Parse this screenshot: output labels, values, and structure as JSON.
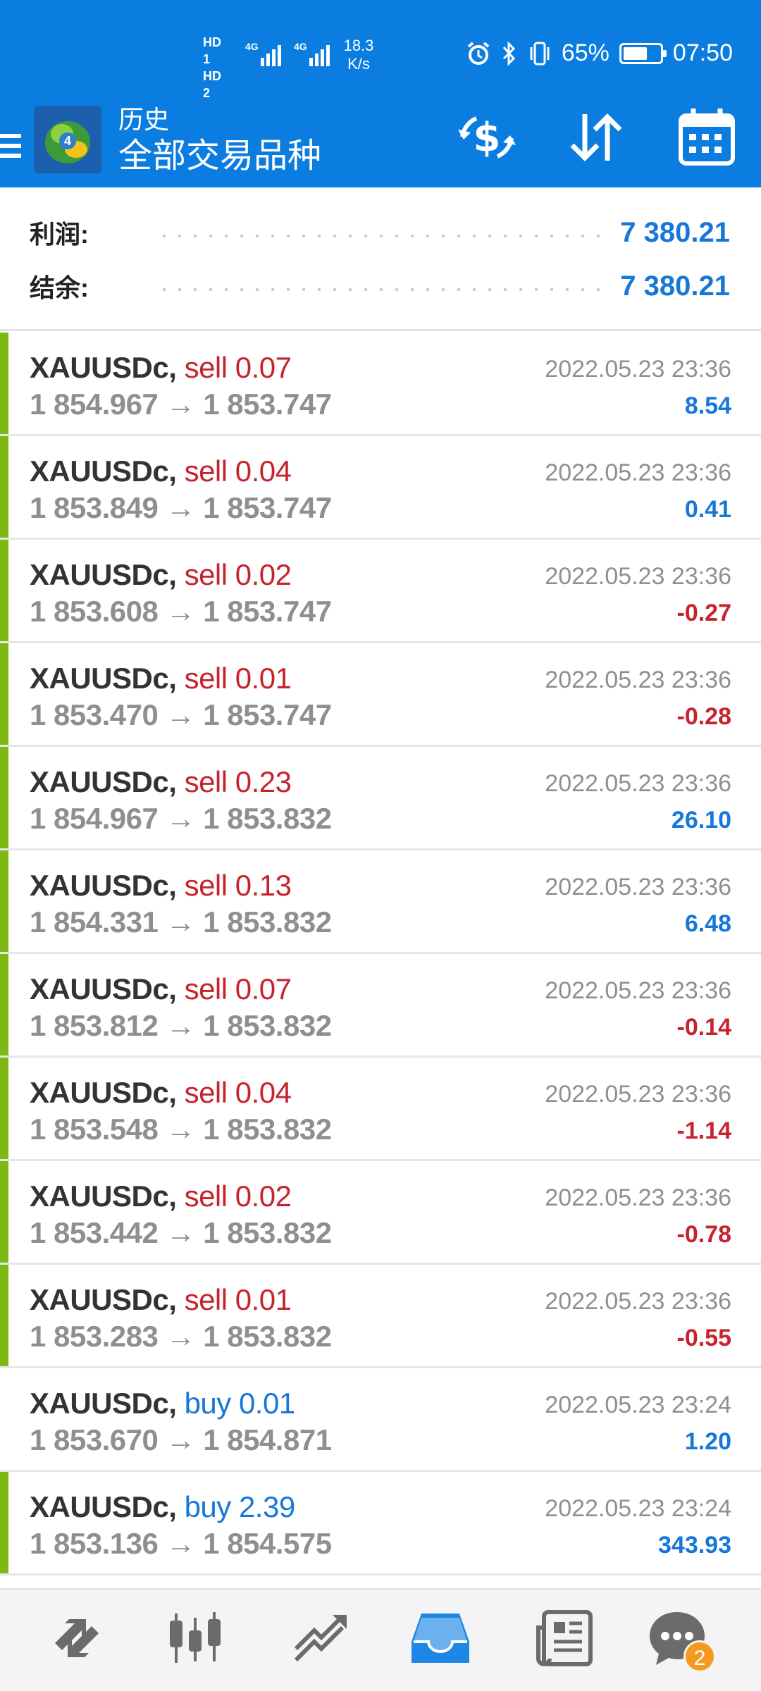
{
  "status_bar": {
    "sim1": "HD 1",
    "sim2": "HD 2",
    "network1": "4G",
    "network2": "4G",
    "speed_value": "18.3",
    "speed_unit": "K/s",
    "battery": "65%",
    "battery_level": 0.65,
    "time": "07:50"
  },
  "header": {
    "subtitle": "历史",
    "title": "全部交易品种"
  },
  "summary": {
    "profit_label": "利润:",
    "profit_value": "7 380.21",
    "balance_label": "结余:",
    "balance_value": "7 380.21"
  },
  "deals": [
    {
      "symbol": "XAUUSDc,",
      "side": "sell",
      "volume": "0.07",
      "open": "1 854.967",
      "close": "1 853.747",
      "time": "2022.05.23 23:36",
      "profit": "8.54",
      "profit_sign": "pos",
      "marked": true
    },
    {
      "symbol": "XAUUSDc,",
      "side": "sell",
      "volume": "0.04",
      "open": "1 853.849",
      "close": "1 853.747",
      "time": "2022.05.23 23:36",
      "profit": "0.41",
      "profit_sign": "pos",
      "marked": true
    },
    {
      "symbol": "XAUUSDc,",
      "side": "sell",
      "volume": "0.02",
      "open": "1 853.608",
      "close": "1 853.747",
      "time": "2022.05.23 23:36",
      "profit": "-0.27",
      "profit_sign": "neg",
      "marked": true
    },
    {
      "symbol": "XAUUSDc,",
      "side": "sell",
      "volume": "0.01",
      "open": "1 853.470",
      "close": "1 853.747",
      "time": "2022.05.23 23:36",
      "profit": "-0.28",
      "profit_sign": "neg",
      "marked": true
    },
    {
      "symbol": "XAUUSDc,",
      "side": "sell",
      "volume": "0.23",
      "open": "1 854.967",
      "close": "1 853.832",
      "time": "2022.05.23 23:36",
      "profit": "26.10",
      "profit_sign": "pos",
      "marked": true
    },
    {
      "symbol": "XAUUSDc,",
      "side": "sell",
      "volume": "0.13",
      "open": "1 854.331",
      "close": "1 853.832",
      "time": "2022.05.23 23:36",
      "profit": "6.48",
      "profit_sign": "pos",
      "marked": true
    },
    {
      "symbol": "XAUUSDc,",
      "side": "sell",
      "volume": "0.07",
      "open": "1 853.812",
      "close": "1 853.832",
      "time": "2022.05.23 23:36",
      "profit": "-0.14",
      "profit_sign": "neg",
      "marked": true
    },
    {
      "symbol": "XAUUSDc,",
      "side": "sell",
      "volume": "0.04",
      "open": "1 853.548",
      "close": "1 853.832",
      "time": "2022.05.23 23:36",
      "profit": "-1.14",
      "profit_sign": "neg",
      "marked": true
    },
    {
      "symbol": "XAUUSDc,",
      "side": "sell",
      "volume": "0.02",
      "open": "1 853.442",
      "close": "1 853.832",
      "time": "2022.05.23 23:36",
      "profit": "-0.78",
      "profit_sign": "neg",
      "marked": true
    },
    {
      "symbol": "XAUUSDc,",
      "side": "sell",
      "volume": "0.01",
      "open": "1 853.283",
      "close": "1 853.832",
      "time": "2022.05.23 23:36",
      "profit": "-0.55",
      "profit_sign": "neg",
      "marked": true
    },
    {
      "symbol": "XAUUSDc,",
      "side": "buy",
      "volume": "0.01",
      "open": "1 853.670",
      "close": "1 854.871",
      "time": "2022.05.23 23:24",
      "profit": "1.20",
      "profit_sign": "pos",
      "marked": false
    },
    {
      "symbol": "XAUUSDc,",
      "side": "buy",
      "volume": "2.39",
      "open": "1 853.136",
      "close": "1 854.575",
      "time": "2022.05.23 23:24",
      "profit": "343.93",
      "profit_sign": "pos",
      "marked": true
    }
  ],
  "arrow_glyph": "→",
  "bottom_nav": {
    "items": [
      "quotes-icon",
      "chart-icon",
      "trade-icon",
      "history-icon",
      "news-icon",
      "chat-icon"
    ],
    "active": "history-icon",
    "chat_badge": "2"
  },
  "colors": {
    "accent": "#0b7de0",
    "profit_positive": "#1677d9",
    "profit_negative": "#c7232d",
    "row_marker": "#7cb912"
  }
}
